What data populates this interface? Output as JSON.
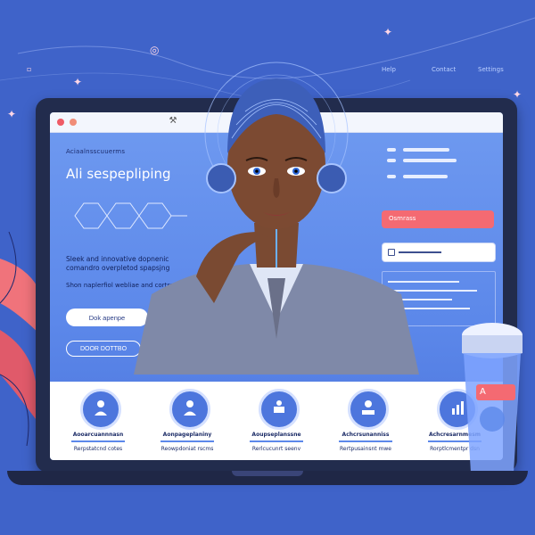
{
  "colors": {
    "background": "#3f63c9",
    "screen": "#5c88ea",
    "accent_red": "#f46a72",
    "bezel": "#222c4d",
    "white": "#ffffff"
  },
  "top_right_labels": [
    "Help",
    "Contact",
    "Settings"
  ],
  "browser": {
    "controls": [
      "close-dot",
      "minimize-dot"
    ],
    "tools_icon": "wrench-icon"
  },
  "hero": {
    "eyebrow": "Aciaalnsscuuerms",
    "title": "Ali sespepliping",
    "description": "Sleek and innovative dopnenic comandro overpletod spapsjng",
    "subtext": "Shon naplerfiol webliae and cortsnmert.",
    "primary_button": "Dok apenpe",
    "outline_button": "DOOR DOTTBO"
  },
  "right_panel": {
    "warning_label": "Osmrass"
  },
  "features": [
    {
      "icon": "person-icon",
      "title": "Aooarcuannnasn",
      "subtitle": "Rerpstatcnd cotes"
    },
    {
      "icon": "person-icon",
      "title": "Aonpageplaniny",
      "subtitle": "Reowpdoniat rscms"
    },
    {
      "icon": "laptop-user-icon",
      "title": "Aoupseplanssne",
      "subtitle": "Rerlcucunrt seenv"
    },
    {
      "icon": "person-laptop-icon",
      "title": "Achcrsunanniss",
      "subtitle": "Rertpusainsnt mwe"
    },
    {
      "icon": "bar-chart-icon",
      "title": "Achcresarnmesm",
      "subtitle": "Rorptlcmentpr dsn"
    }
  ],
  "cup_label": "A"
}
